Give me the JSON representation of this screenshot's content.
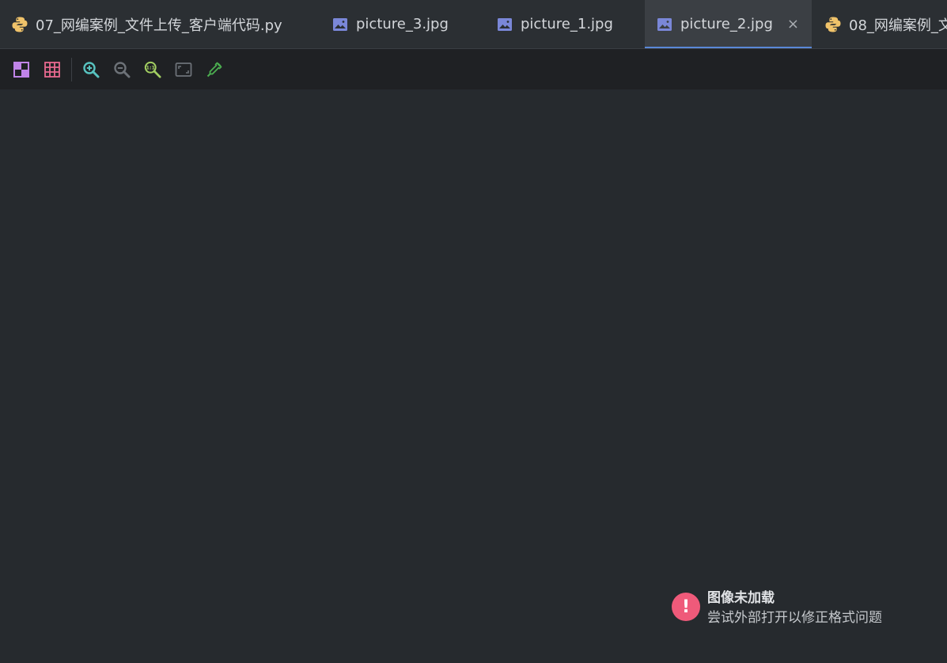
{
  "tabs": [
    {
      "label": "07_网编案例_文件上传_客户端代码.py",
      "icon": "python-icon",
      "active": false
    },
    {
      "label": "picture_3.jpg",
      "icon": "image-icon",
      "active": false
    },
    {
      "label": "picture_1.jpg",
      "icon": "image-icon",
      "active": false
    },
    {
      "label": "picture_2.jpg",
      "icon": "image-icon",
      "active": true,
      "close": "×"
    },
    {
      "label": "08_网编案例_文",
      "icon": "python-icon",
      "active": false
    }
  ],
  "toolbar": {
    "tools": [
      "chessboard-icon",
      "grid-icon",
      "zoom-in-icon",
      "zoom-out-icon",
      "actual-size-icon",
      "fit-to-window-icon",
      "color-picker-icon"
    ]
  },
  "notification": {
    "title": "图像未加载",
    "description": "尝试外部打开以修正格式问题",
    "badge": "!"
  },
  "colors": {
    "accent": "#5a88d8",
    "error": "#ef5a7a",
    "background": "#262a2e",
    "tab_bar": "#2b2f33",
    "toolbar": "#1f2124"
  }
}
